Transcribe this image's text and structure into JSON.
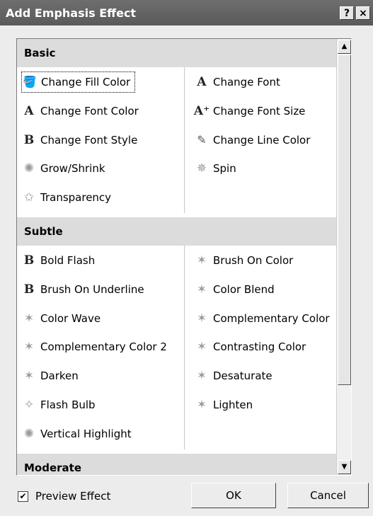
{
  "window": {
    "title": "Add Emphasis Effect",
    "help_label": "?",
    "close_label": "×"
  },
  "groups": [
    {
      "name": "Basic",
      "left": [
        {
          "label": "Change Fill Color",
          "icon": "paint-bucket-icon"
        },
        {
          "label": "Change Font Color",
          "icon": "font-color-icon"
        },
        {
          "label": "Change Font Style",
          "icon": "bold-b-icon"
        },
        {
          "label": "Grow/Shrink",
          "icon": "star-grow-icon"
        },
        {
          "label": "Transparency",
          "icon": "star-transparency-icon"
        }
      ],
      "right": [
        {
          "label": "Change Font",
          "icon": "font-a-icon"
        },
        {
          "label": "Change Font Size",
          "icon": "font-size-icon"
        },
        {
          "label": "Change Line Color",
          "icon": "pen-line-icon"
        },
        {
          "label": "Spin",
          "icon": "spin-star-icon"
        }
      ]
    },
    {
      "name": "Subtle",
      "left": [
        {
          "label": "Bold Flash",
          "icon": "bold-b-icon"
        },
        {
          "label": "Brush On Underline",
          "icon": "bold-b-icon"
        },
        {
          "label": "Color Wave",
          "icon": "sparkle-star-icon"
        },
        {
          "label": "Complementary Color 2",
          "icon": "sparkle-star-icon"
        },
        {
          "label": "Darken",
          "icon": "sparkle-star-icon"
        },
        {
          "label": "Flash Bulb",
          "icon": "flash-bulb-icon"
        },
        {
          "label": "Vertical Highlight",
          "icon": "star-grow-icon"
        }
      ],
      "right": [
        {
          "label": "Brush On Color",
          "icon": "sparkle-star-icon"
        },
        {
          "label": "Color Blend",
          "icon": "sparkle-star-icon"
        },
        {
          "label": "Complementary Color",
          "icon": "sparkle-star-icon"
        },
        {
          "label": "Contrasting Color",
          "icon": "sparkle-star-icon"
        },
        {
          "label": "Desaturate",
          "icon": "sparkle-star-icon"
        },
        {
          "label": "Lighten",
          "icon": "sparkle-star-icon"
        }
      ]
    },
    {
      "name": "Moderate",
      "left": [],
      "right": []
    }
  ],
  "selected_effect": "Change Fill Color",
  "preview": {
    "label": "Preview Effect",
    "checked": true
  },
  "buttons": {
    "ok": "OK",
    "cancel": "Cancel"
  },
  "scroll": {
    "up": "▲",
    "down": "▼"
  }
}
